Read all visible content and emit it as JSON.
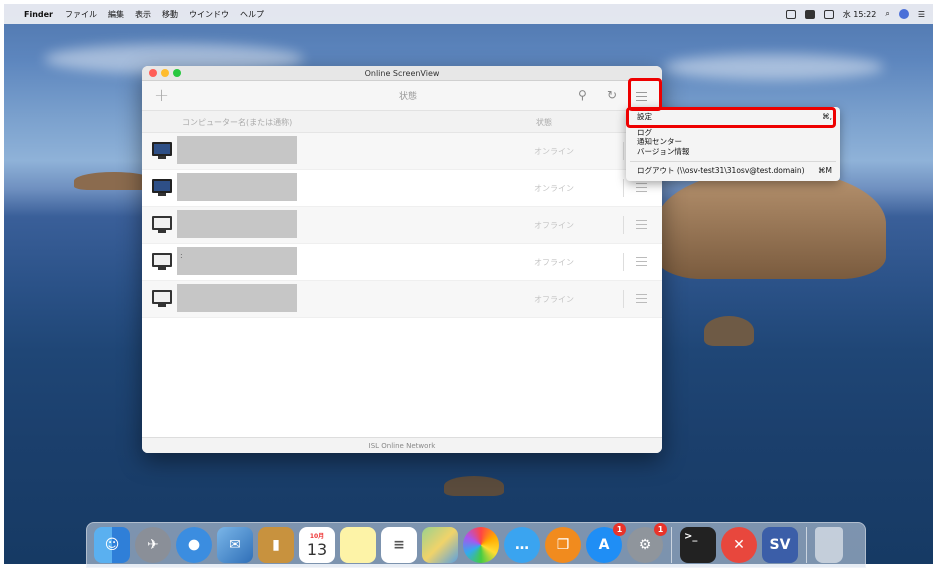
{
  "menubar": {
    "apple": "",
    "app_name": "Finder",
    "items": [
      "ファイル",
      "編集",
      "表示",
      "移動",
      "ウインドウ",
      "ヘルプ"
    ],
    "clock": "水 15:22"
  },
  "window": {
    "title": "Online ScreenView",
    "status_filter": "状態",
    "columns": {
      "computer_name": "コンピューター名(または通称)",
      "status": "状態"
    },
    "footer": "ISL Online Network"
  },
  "computers": [
    {
      "name": "",
      "status": "オンライン",
      "state": "online"
    },
    {
      "name": "",
      "status": "オンライン",
      "state": "online"
    },
    {
      "name": "",
      "status": "オフライン",
      "state": "offline"
    },
    {
      "name": ":",
      "status": "オフライン",
      "state": "offline"
    },
    {
      "name": "",
      "status": "オフライン",
      "state": "offline"
    }
  ],
  "dropdown": {
    "settings": "設定",
    "settings_shortcut": "⌘,",
    "log": "ログ",
    "notification_center": "通知センター",
    "version_info": "バージョン情報",
    "logout": "ログアウト (\\\\osv-test31\\31osv@test.domain)",
    "logout_shortcut": "⌘M"
  },
  "dock": {
    "calendar_month": "10月",
    "calendar_day": "13",
    "badge_appstore": "1",
    "badge_prefs": "1",
    "sv_label": "SV"
  },
  "colors": {
    "highlight": "#e00000",
    "online_screen": "#2e4f86"
  }
}
